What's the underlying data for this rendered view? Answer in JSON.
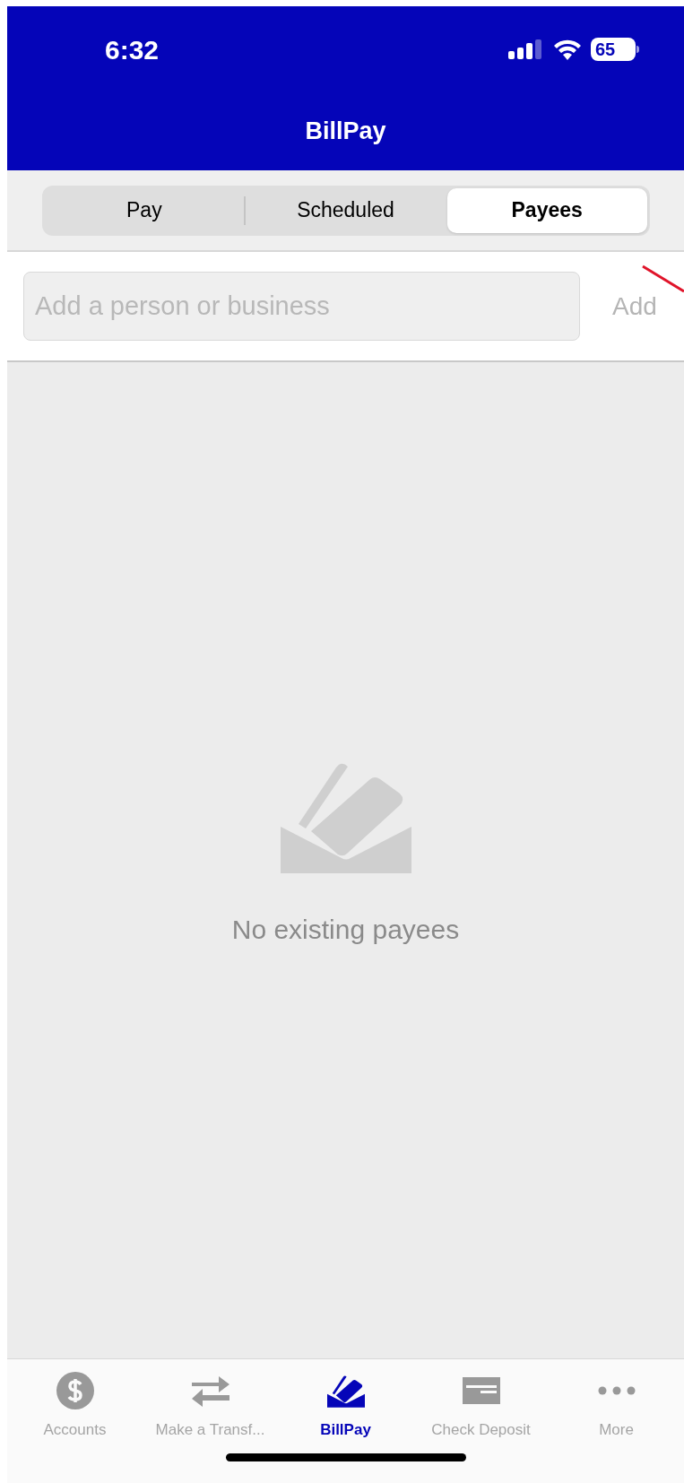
{
  "status_bar": {
    "time": "6:32",
    "battery": "65"
  },
  "header": {
    "title": "BillPay"
  },
  "segments": [
    {
      "label": "Pay",
      "selected": false
    },
    {
      "label": "Scheduled",
      "selected": false
    },
    {
      "label": "Payees",
      "selected": true
    }
  ],
  "search": {
    "placeholder": "Add a person or business",
    "button": "Add"
  },
  "empty_state": {
    "message": "No existing payees"
  },
  "tab_bar": [
    {
      "kind": "dollar",
      "label": "Accounts",
      "selected": false
    },
    {
      "kind": "transfer",
      "label": "Make a Transf...",
      "selected": false
    },
    {
      "kind": "billpay",
      "label": "BillPay",
      "selected": true
    },
    {
      "kind": "check",
      "label": "Check Deposit",
      "selected": false
    },
    {
      "kind": "more",
      "label": "More",
      "selected": false
    }
  ]
}
